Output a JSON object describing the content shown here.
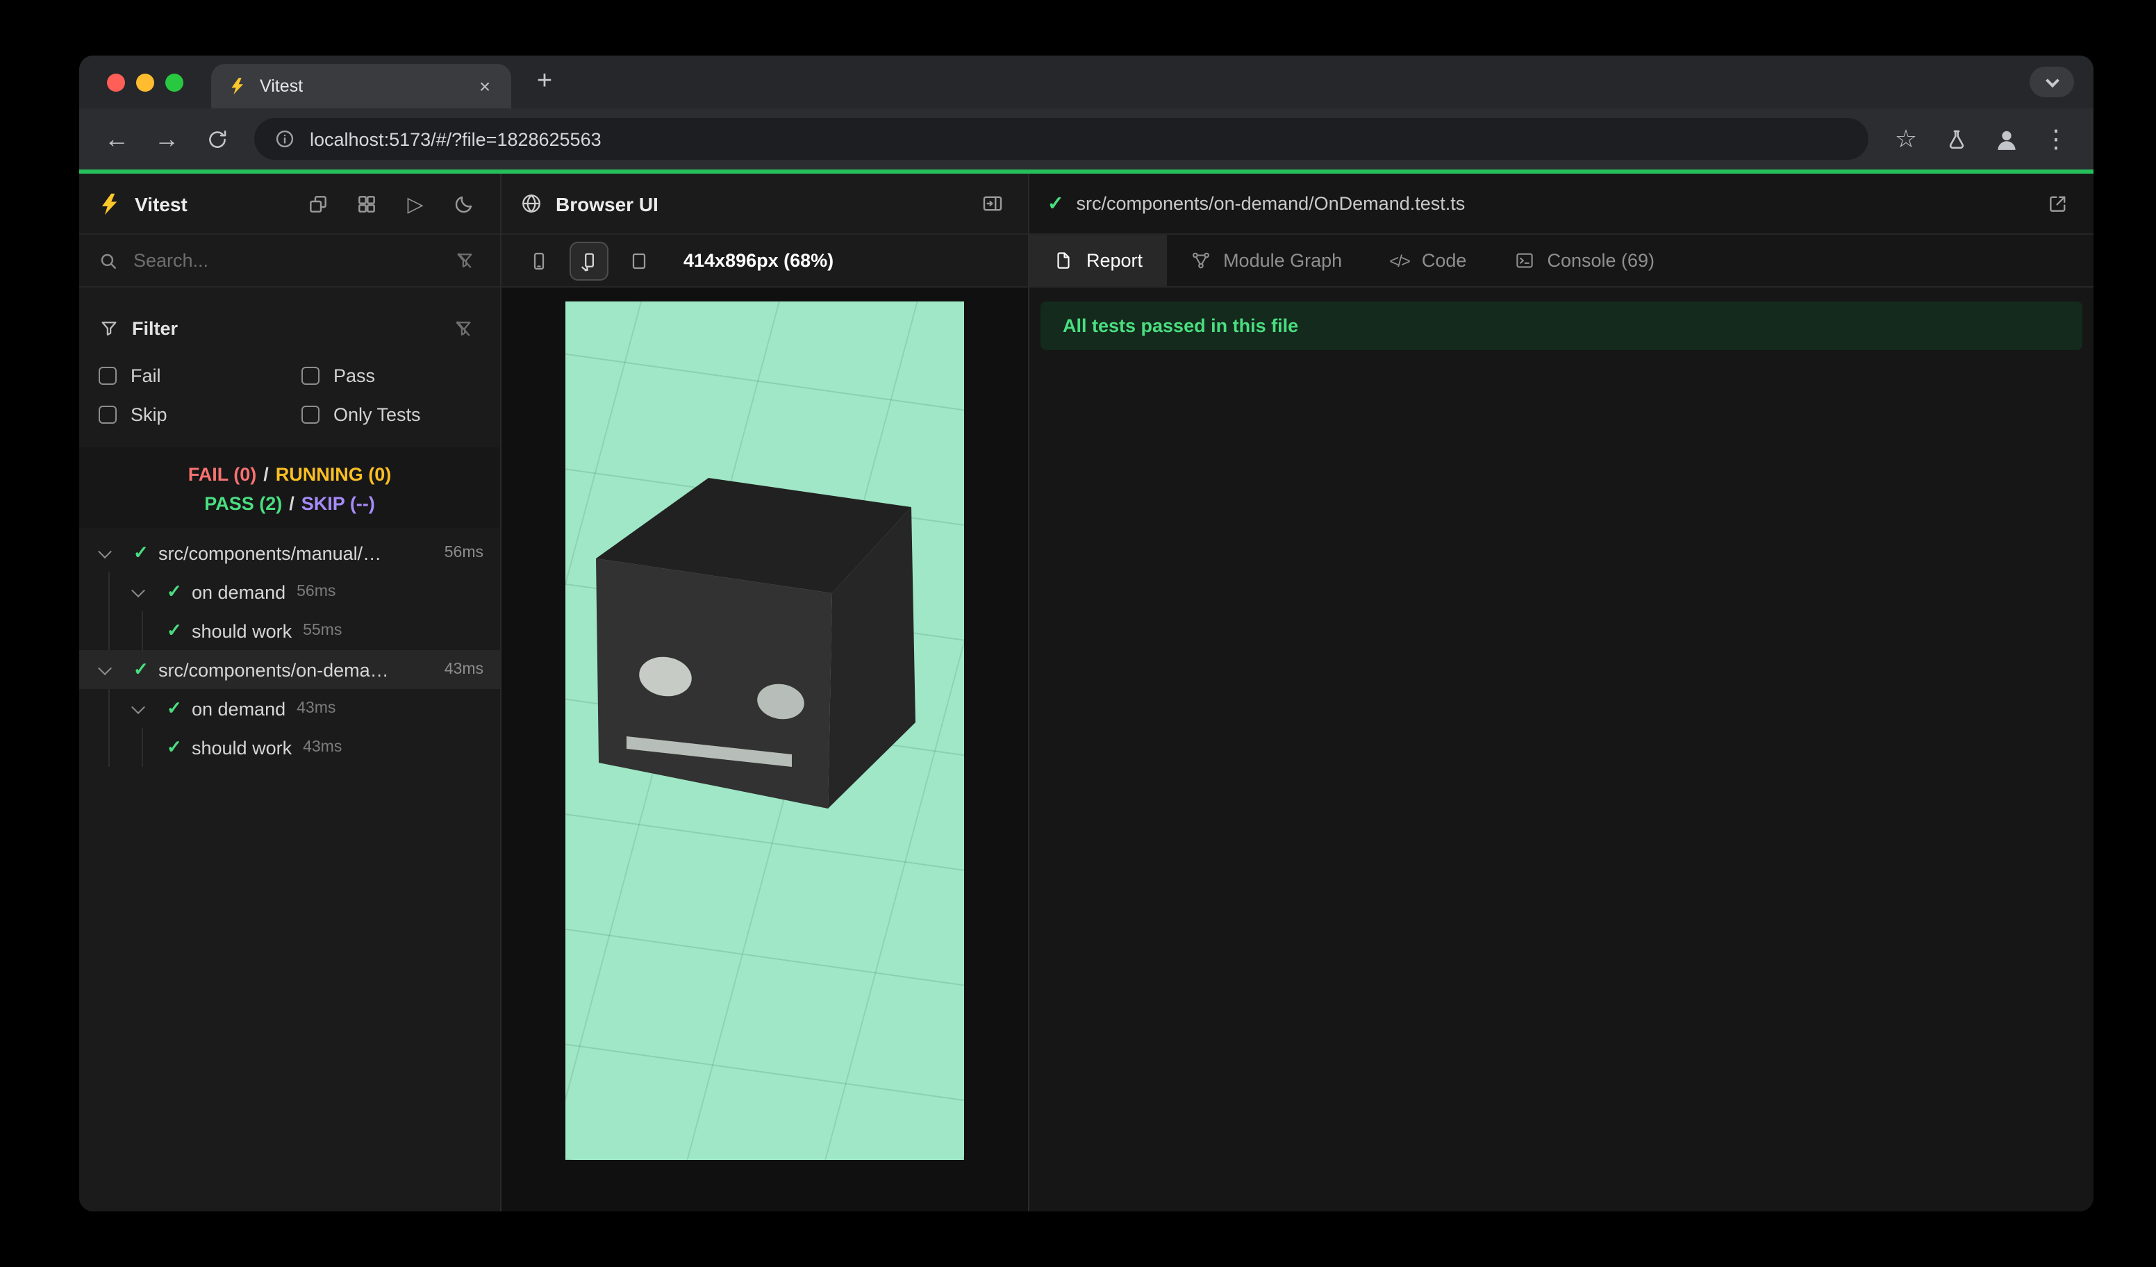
{
  "browser": {
    "tab_title": "Vitest",
    "url": "localhost:5173/#/?file=1828625563"
  },
  "icons": {
    "back": "←",
    "forward": "→",
    "tab_close": "×",
    "new_tab": "+",
    "kebab": "⋮",
    "star": "☆",
    "run_all": "▷",
    "check": "✓",
    "code_tab": "</>"
  },
  "left": {
    "app_title": "Vitest",
    "search_placeholder": "Search...",
    "filter": {
      "label": "Filter",
      "options": [
        "Fail",
        "Pass",
        "Skip",
        "Only Tests"
      ]
    },
    "summary": {
      "fail": "FAIL (0)",
      "running": "RUNNING (0)",
      "pass": "PASS (2)",
      "skip": "SKIP (--)",
      "sep": "/"
    },
    "tree": [
      {
        "label": "src/components/manual/…",
        "time": "56ms"
      },
      {
        "label": "on demand",
        "time": "56ms"
      },
      {
        "label": "should work",
        "time": "55ms"
      },
      {
        "label": "src/components/on-dema…",
        "time": "43ms"
      },
      {
        "label": "on demand",
        "time": "43ms"
      },
      {
        "label": "should work",
        "time": "43ms"
      }
    ]
  },
  "middle": {
    "title": "Browser UI",
    "viewport_label": "414x896px (68%)"
  },
  "right": {
    "file_path": "src/components/on-demand/OnDemand.test.ts",
    "tabs": [
      "Report",
      "Module Graph",
      "Code",
      "Console (69)"
    ],
    "banner": "All tests passed in this file"
  },
  "colors": {
    "pass_green": "#4ade80",
    "fail_red": "#f87171",
    "running_yellow": "#fbbf24",
    "skip_purple": "#a78bfa",
    "accent_line": "#25c05b",
    "viewport_bg": "#9fe7c6"
  }
}
